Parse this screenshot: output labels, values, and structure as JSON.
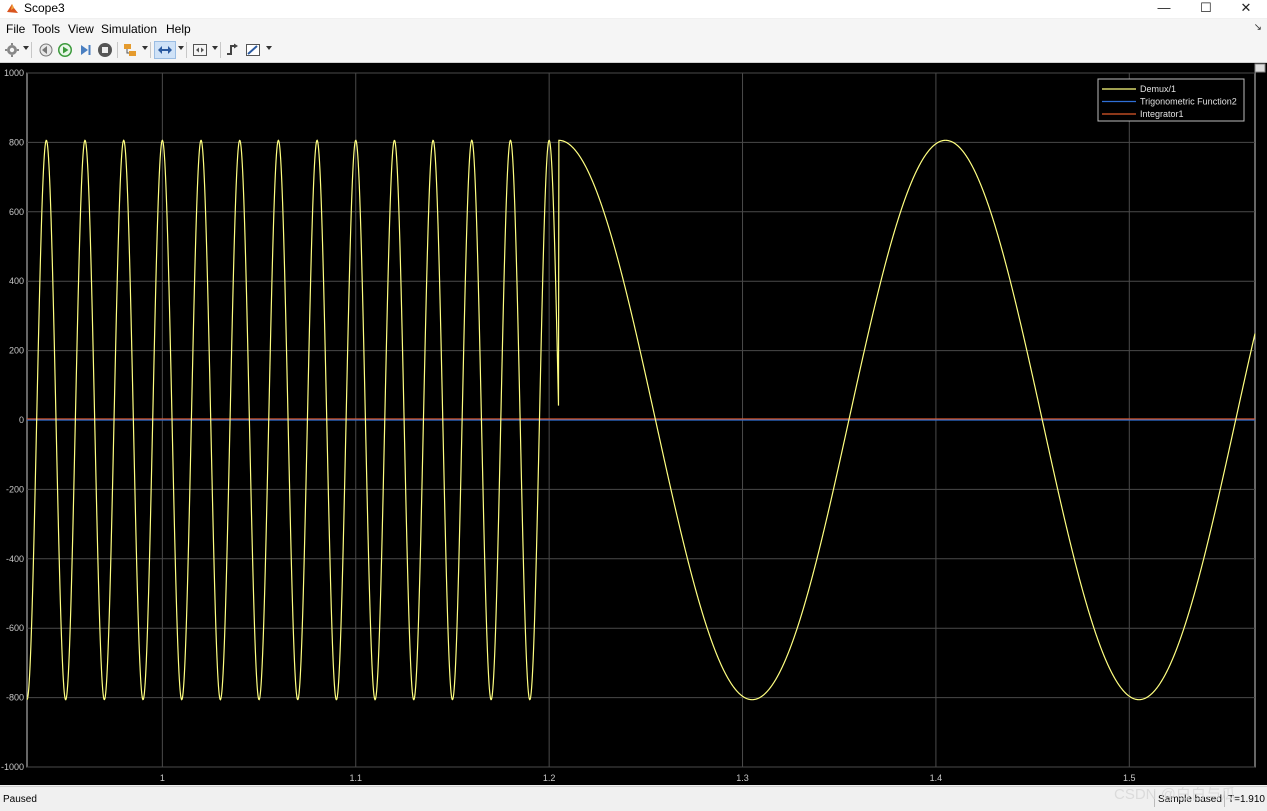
{
  "window": {
    "title": "Scope3",
    "controls": {
      "minimize": "—",
      "maximize": "☐",
      "close": "✕"
    }
  },
  "menu": {
    "items": [
      "File",
      "Tools",
      "View",
      "Simulation",
      "Help"
    ]
  },
  "toolbar": {
    "icons": [
      "settings-icon",
      "step-back-icon",
      "run-icon",
      "step-forward-icon",
      "stop-icon",
      "highlight-simulink-block-icon",
      "zoom-icon",
      "scale-axes-icon",
      "triggers-icon",
      "measurements-icon"
    ]
  },
  "status": {
    "state": "Paused",
    "sampling": "Sample based",
    "time": "T=1.910"
  },
  "watermark": "CSDN @白白与瓜",
  "colors": {
    "plot_background": "#000000",
    "grid": "#4a4a4a",
    "axis": "#cccccc",
    "tick_label": "#c8c8c8",
    "demux": "#ffff80",
    "trig": "#2f6fd6",
    "integrator": "#e05a2b"
  },
  "chart_data": {
    "type": "line",
    "xlim": [
      0.93,
      1.565
    ],
    "ylim": [
      -1000,
      1000
    ],
    "xticks": [
      1,
      1.1,
      1.2,
      1.3,
      1.4,
      1.5
    ],
    "yticks": [
      1000,
      800,
      600,
      400,
      200,
      0,
      -200,
      -400,
      -600,
      -800,
      -1000
    ],
    "xtick_labels": [
      "1",
      "1.1",
      "1.2",
      "1.3",
      "1.4",
      "1.5"
    ],
    "ytick_labels": [
      "1000",
      "800",
      "600",
      "400",
      "200",
      "0",
      "-200",
      "-400",
      "-600",
      "-800",
      "-1000"
    ],
    "grid": true,
    "legend_position": "top-right",
    "legend": [
      "Demux/1",
      "Trigonometric Function2",
      "Integrator1"
    ],
    "series": [
      {
        "name": "Demux/1",
        "amplitude": 806,
        "segments": [
          {
            "x_start": 0.93,
            "x_end": 1.205,
            "frequency_hz": 50
          },
          {
            "x_start": 1.205,
            "x_end": 1.565,
            "frequency_hz": 5
          }
        ]
      },
      {
        "name": "Trigonometric Function2",
        "constant_value": 0
      },
      {
        "name": "Integrator1",
        "approx_value": 3
      }
    ]
  }
}
